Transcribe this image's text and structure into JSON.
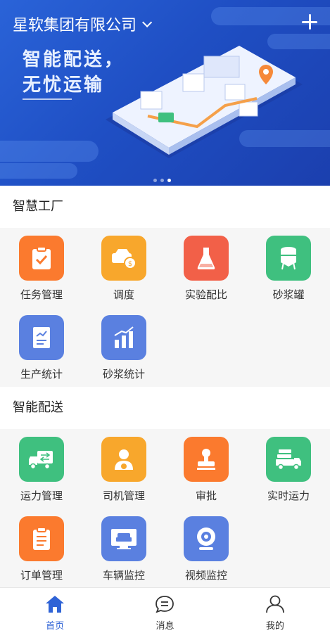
{
  "header": {
    "company": "星软集团有限公司",
    "slogan_line1": "智能配送，",
    "slogan_line2": "无忧运输"
  },
  "sections": [
    {
      "title": "智慧工厂",
      "items": [
        {
          "label": "任务管理",
          "icon": "clipboard-check-icon",
          "color": "#fb7a2e"
        },
        {
          "label": "调度",
          "icon": "truck-dispatch-icon",
          "color": "#f8a72c"
        },
        {
          "label": "实验配比",
          "icon": "flask-icon",
          "color": "#f26048"
        },
        {
          "label": "砂浆罐",
          "icon": "tank-icon",
          "color": "#3fc07f"
        },
        {
          "label": "生产统计",
          "icon": "chart-doc-icon",
          "color": "#5a80e0"
        },
        {
          "label": "砂浆统计",
          "icon": "bar-chart-icon",
          "color": "#5a80e0"
        }
      ]
    },
    {
      "title": "智能配送",
      "items": [
        {
          "label": "运力管理",
          "icon": "truck-exchange-icon",
          "color": "#3fc07f"
        },
        {
          "label": "司机管理",
          "icon": "driver-icon",
          "color": "#f8a72c"
        },
        {
          "label": "审批",
          "icon": "stamp-icon",
          "color": "#fb7a2e"
        },
        {
          "label": "实时运力",
          "icon": "truck-cargo-icon",
          "color": "#3fc07f"
        },
        {
          "label": "订单管理",
          "icon": "order-clipboard-icon",
          "color": "#fb7a2e"
        },
        {
          "label": "车辆监控",
          "icon": "vehicle-monitor-icon",
          "color": "#5a80e0"
        },
        {
          "label": "视频监控",
          "icon": "webcam-icon",
          "color": "#5a80e0"
        }
      ]
    }
  ],
  "tabbar": [
    {
      "label": "首页",
      "icon": "home-icon",
      "active": true
    },
    {
      "label": "消息",
      "icon": "message-icon",
      "active": false
    },
    {
      "label": "我的",
      "icon": "user-icon",
      "active": false
    }
  ],
  "colors": {
    "brand": "#2f63d6",
    "banner": "#1f4fc4"
  }
}
